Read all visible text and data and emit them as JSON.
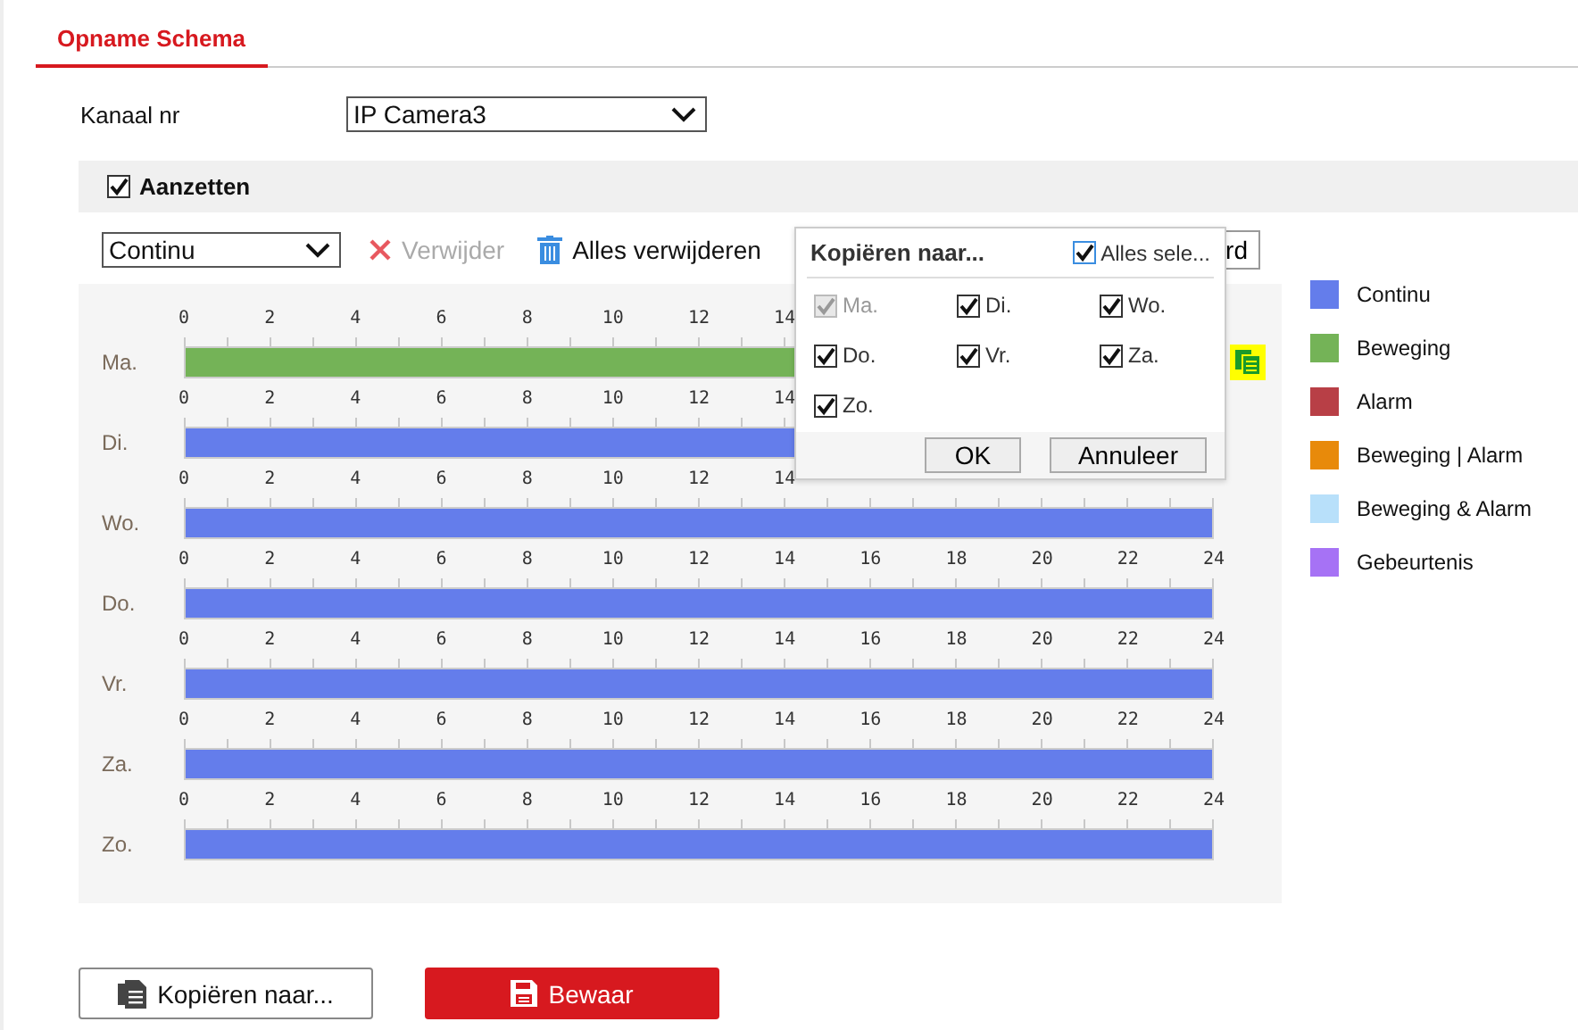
{
  "tab": {
    "label": "Opname Schema",
    "selected": true
  },
  "channel": {
    "label": "Kanaal nr",
    "value": "IP Camera3"
  },
  "enable": {
    "label": "Aanzetten",
    "checked": true
  },
  "toolbar": {
    "mode": "Continu",
    "delete": {
      "label": "Verwijder",
      "disabled": true
    },
    "delete_all": {
      "label": "Alles verwijderen",
      "disabled": false
    },
    "partial_button": "rd"
  },
  "schedule": [
    {
      "day": "Ma.",
      "color": "#74b357",
      "copy_icon": true,
      "ticks": [
        "0",
        "2",
        "4",
        "6",
        "8",
        "10",
        "12",
        "14"
      ]
    },
    {
      "day": "Di.",
      "color": "#647deb",
      "copy_icon": false,
      "ticks": [
        "0",
        "2",
        "4",
        "6",
        "8",
        "10",
        "12",
        "14"
      ]
    },
    {
      "day": "Wo.",
      "color": "#647deb",
      "copy_icon": false,
      "ticks": [
        "0",
        "2",
        "4",
        "6",
        "8",
        "10",
        "12",
        "14"
      ]
    },
    {
      "day": "Do.",
      "color": "#647deb",
      "copy_icon": false,
      "ticks": [
        "0",
        "2",
        "4",
        "6",
        "8",
        "10",
        "12",
        "14",
        "16",
        "18",
        "20",
        "22",
        "24"
      ]
    },
    {
      "day": "Vr.",
      "color": "#647deb",
      "copy_icon": false,
      "ticks": [
        "0",
        "2",
        "4",
        "6",
        "8",
        "10",
        "12",
        "14",
        "16",
        "18",
        "20",
        "22",
        "24"
      ]
    },
    {
      "day": "Za.",
      "color": "#647deb",
      "copy_icon": false,
      "ticks": [
        "0",
        "2",
        "4",
        "6",
        "8",
        "10",
        "12",
        "14",
        "16",
        "18",
        "20",
        "22",
        "24"
      ]
    },
    {
      "day": "Zo.",
      "color": "#647deb",
      "copy_icon": false,
      "ticks": [
        "0",
        "2",
        "4",
        "6",
        "8",
        "10",
        "12",
        "14",
        "16",
        "18",
        "20",
        "22",
        "24"
      ]
    }
  ],
  "legend": [
    {
      "label": "Continu",
      "color": "#647deb"
    },
    {
      "label": "Beweging",
      "color": "#74b357"
    },
    {
      "label": "Alarm",
      "color": "#b83f46"
    },
    {
      "label": "Beweging | Alarm",
      "color": "#e88a0a"
    },
    {
      "label": "Beweging & Alarm",
      "color": "#b8e0fa"
    },
    {
      "label": "Gebeurtenis",
      "color": "#a672f5"
    }
  ],
  "popup": {
    "title": "Kopiëren naar...",
    "select_all": {
      "label": "Alles sele...",
      "checked": true
    },
    "days": [
      {
        "label": "Ma.",
        "checked": true,
        "disabled": true
      },
      {
        "label": "Di.",
        "checked": true,
        "disabled": false
      },
      {
        "label": "Wo.",
        "checked": true,
        "disabled": false
      },
      {
        "label": "Do.",
        "checked": true,
        "disabled": false
      },
      {
        "label": "Vr.",
        "checked": true,
        "disabled": false
      },
      {
        "label": "Za.",
        "checked": true,
        "disabled": false
      },
      {
        "label": "Zo.",
        "checked": true,
        "disabled": false
      }
    ],
    "buttons": [
      "OK",
      "Annuleer"
    ]
  },
  "actions": {
    "copy": "Kopiëren naar...",
    "save": "Bewaar"
  }
}
